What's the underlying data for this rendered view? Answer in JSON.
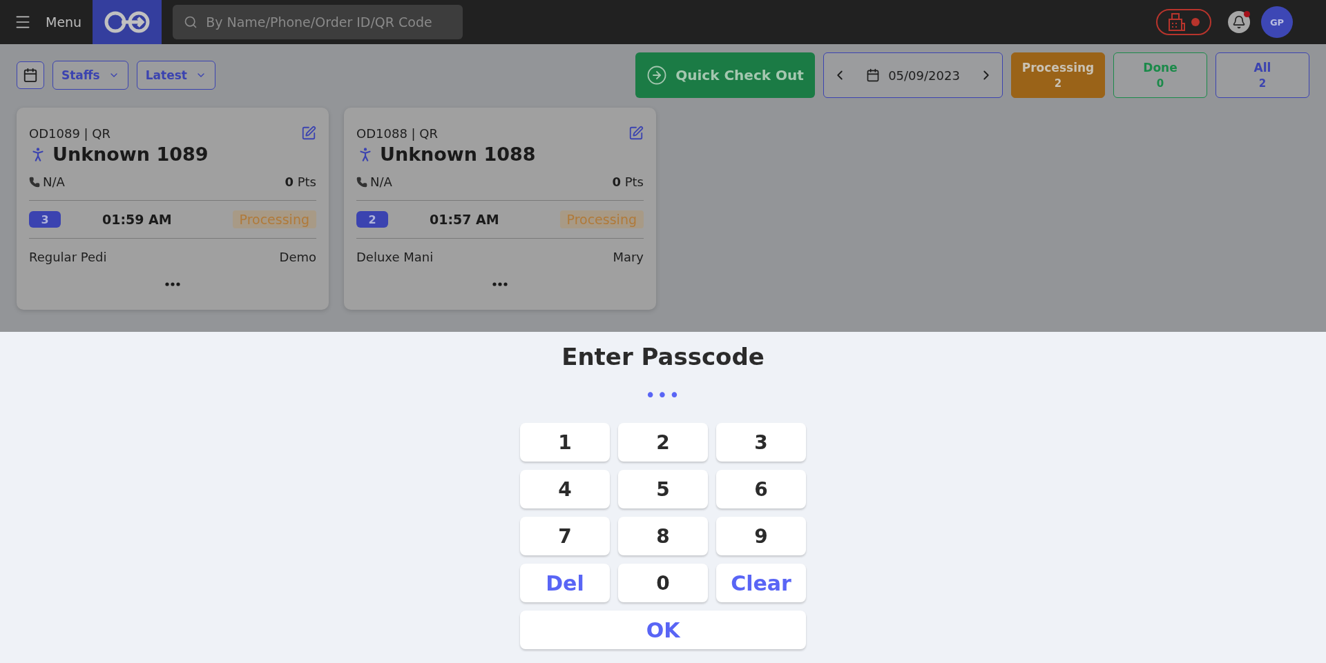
{
  "topbar": {
    "menu_label": "Menu",
    "search": {
      "placeholder": "By Name/Phone/Order ID/QR Code"
    },
    "avatar": "GP",
    "notification_unread": true,
    "printer_connected": false
  },
  "toolbar": {
    "staff_filter": "Staffs",
    "sort": "Latest",
    "quick_checkout": "Quick Check Out",
    "date": "05/09/2023",
    "status_tabs": [
      {
        "label": "Processing",
        "count": "2",
        "selected": true,
        "color": "#9a6318"
      },
      {
        "label": "Done",
        "count": "0",
        "selected": false,
        "color": "#1b8a4a"
      },
      {
        "label": "All",
        "count": "2",
        "selected": false,
        "color": "#3b43b0"
      }
    ]
  },
  "orders": [
    {
      "id": "OD1089 | QR",
      "name": "Unknown 1089",
      "phone": "N/A",
      "points": "0",
      "points_unit": "Pts",
      "queue": "3",
      "time": "01:59 AM",
      "status": "Processing",
      "service": "Regular Pedi",
      "staff": "Demo"
    },
    {
      "id": "OD1088 | QR",
      "name": "Unknown 1088",
      "phone": "N/A",
      "points": "0",
      "points_unit": "Pts",
      "queue": "2",
      "time": "01:57 AM",
      "status": "Processing",
      "service": "Deluxe Mani",
      "staff": "Mary"
    }
  ],
  "passcode": {
    "title": "Enter Passcode",
    "value": "•••",
    "keys": [
      {
        "label": "1",
        "kind": "digit"
      },
      {
        "label": "2",
        "kind": "digit"
      },
      {
        "label": "3",
        "kind": "digit"
      },
      {
        "label": "4",
        "kind": "digit"
      },
      {
        "label": "5",
        "kind": "digit"
      },
      {
        "label": "6",
        "kind": "digit"
      },
      {
        "label": "7",
        "kind": "digit"
      },
      {
        "label": "8",
        "kind": "digit"
      },
      {
        "label": "9",
        "kind": "digit"
      },
      {
        "label": "Del",
        "kind": "action"
      },
      {
        "label": "0",
        "kind": "digit"
      },
      {
        "label": "Clear",
        "kind": "action"
      }
    ],
    "ok": "OK"
  }
}
